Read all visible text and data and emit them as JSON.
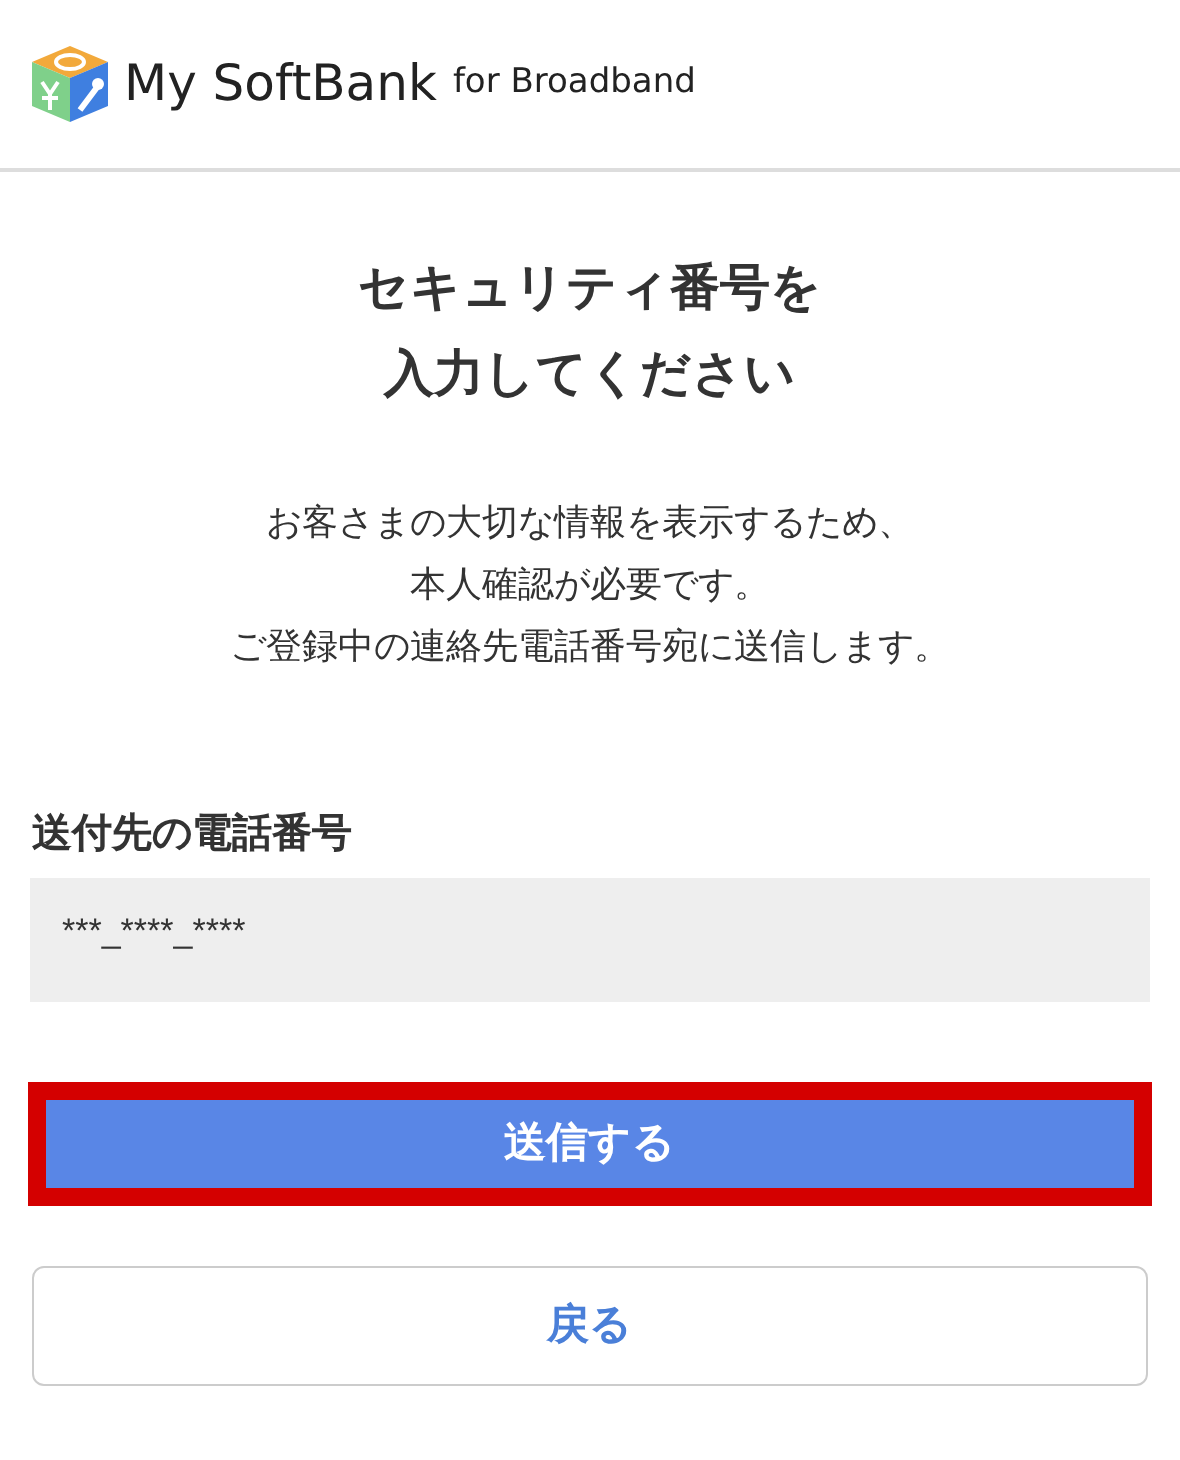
{
  "header": {
    "logo_text": "My SoftBank",
    "logo_subtext": "for Broadband"
  },
  "title_lines": [
    "セキュリティ番号を",
    "入力してください"
  ],
  "description_lines": [
    "お客さまの大切な情報を表示するため、",
    "本人確認が必要です。",
    "ご登録中の連絡先電話番号宛に送信します。"
  ],
  "phone_field": {
    "label": "送付先の電話番号",
    "value": "***_****_****"
  },
  "buttons": [
    {
      "kind": "primary",
      "label": "送信する",
      "highlighted": true
    },
    {
      "kind": "secondary",
      "label": "戻る",
      "highlighted": false
    }
  ]
}
